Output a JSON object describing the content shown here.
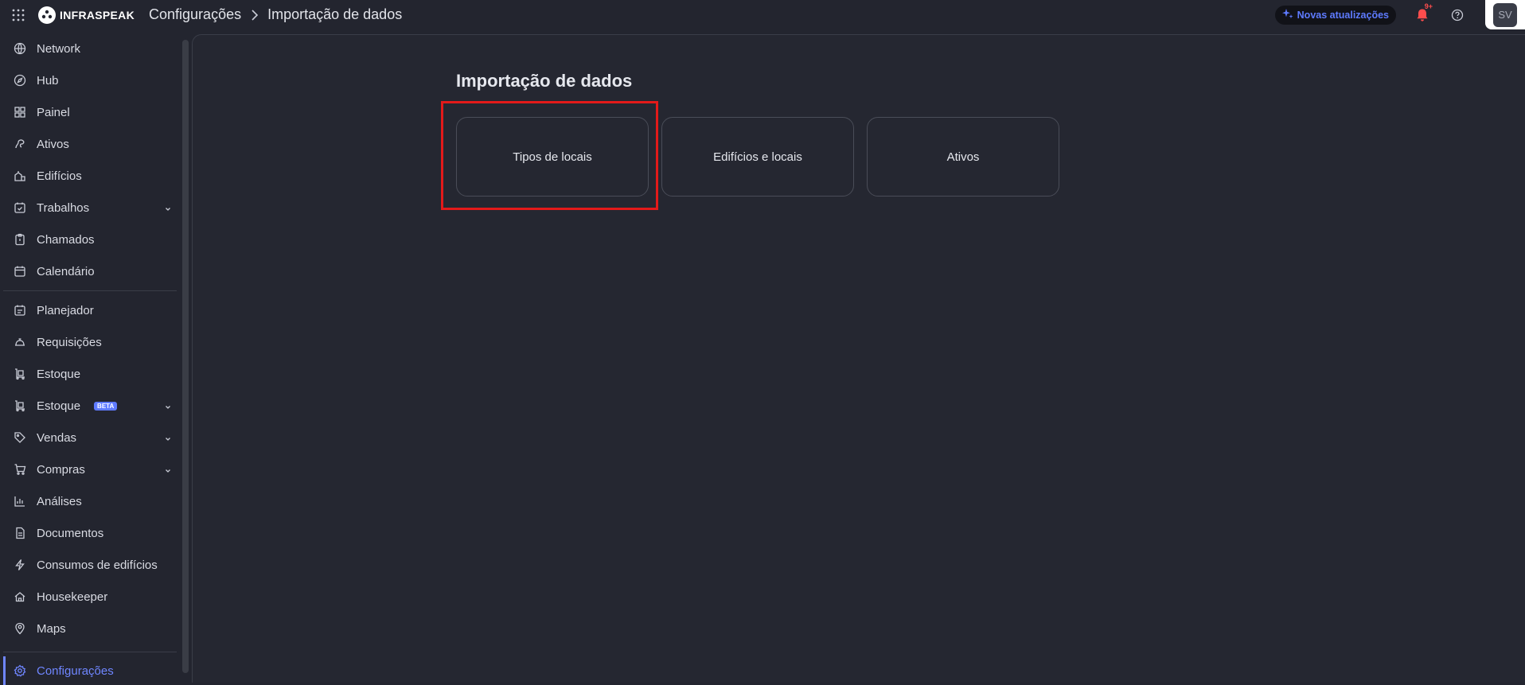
{
  "topbar": {
    "logo_text": "INFRASPEAK",
    "breadcrumb": {
      "parent": "Configurações",
      "current": "Importação de dados"
    },
    "updates_label": "Novas atualizações",
    "notifications_badge": "9+",
    "avatar_initials": "SV"
  },
  "sidebar": {
    "items": [
      {
        "label": "Network",
        "icon": "globe-icon"
      },
      {
        "label": "Hub",
        "icon": "compass-icon"
      },
      {
        "label": "Painel",
        "icon": "dashboard-icon"
      },
      {
        "label": "Ativos",
        "icon": "asset-icon"
      },
      {
        "label": "Edifícios",
        "icon": "building-icon"
      },
      {
        "label": "Trabalhos",
        "icon": "calendar-check-icon",
        "has_children": true
      },
      {
        "label": "Chamados",
        "icon": "clipboard-icon"
      },
      {
        "label": "Calendário",
        "icon": "calendar-icon"
      },
      {
        "label": "Planejador",
        "icon": "planner-icon"
      },
      {
        "label": "Requisições",
        "icon": "bell-service-icon"
      },
      {
        "label": "Estoque",
        "icon": "stock-icon"
      },
      {
        "label": "Estoque",
        "icon": "stock-icon",
        "badge": "BETA",
        "has_children": true
      },
      {
        "label": "Vendas",
        "icon": "tag-icon",
        "has_children": true
      },
      {
        "label": "Compras",
        "icon": "cart-icon",
        "has_children": true
      },
      {
        "label": "Análises",
        "icon": "chart-icon"
      },
      {
        "label": "Documentos",
        "icon": "document-icon"
      },
      {
        "label": "Consumos de edifícios",
        "icon": "bolt-icon"
      },
      {
        "label": "Housekeeper",
        "icon": "housekeeper-icon"
      },
      {
        "label": "Maps",
        "icon": "map-pin-icon"
      },
      {
        "label": "Configurações",
        "icon": "gear-icon",
        "active": true
      }
    ]
  },
  "main": {
    "title": "Importação de dados",
    "cards": [
      {
        "label": "Tipos de locais"
      },
      {
        "label": "Edifícios e locais"
      },
      {
        "label": "Ativos"
      }
    ]
  },
  "colors": {
    "background": "#23252f",
    "accent": "#6f86ff",
    "highlight": "#e31a1a",
    "notification": "#ff4d4d"
  }
}
